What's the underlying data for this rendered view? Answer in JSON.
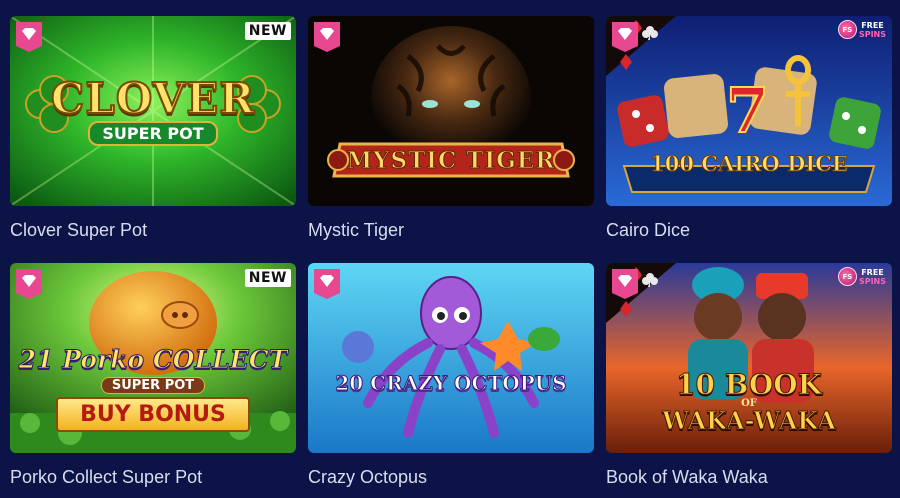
{
  "games": [
    {
      "title": "Clover Super Pot",
      "badge": "NEW",
      "logo_main": "CLOVER",
      "logo_sub": "SUPER POT"
    },
    {
      "title": "Mystic Tiger",
      "logo_main": "MYSTIC TIGER"
    },
    {
      "title": "Cairo Dice",
      "logo_main": "100 CAIRO DICE",
      "free_spins": [
        "FREE",
        "SPINS"
      ],
      "fs_logo": "FS"
    },
    {
      "title": "Porko Collect Super Pot",
      "badge": "NEW",
      "logo_main": "21 Porko COLLECT",
      "logo_sub": "SUPER POT",
      "logo_cta": "BUY BONUS"
    },
    {
      "title": "Crazy Octopus",
      "logo_main": "20 CRAZY OCTOPUS"
    },
    {
      "title": "Book of Waka Waka",
      "logo_main": "10 BOOK",
      "logo_mid": "OF",
      "logo_sub": "WAKA-WAKA",
      "free_spins": [
        "FREE",
        "SPINS"
      ],
      "fs_logo": "FS"
    }
  ],
  "colors": {
    "background": "#0c1447",
    "title_text": "#d9dcef",
    "gem_badge": "#e8488f"
  },
  "icons": [
    "diamond-gem-icon",
    "card-suits-icon",
    "free-spins-icon"
  ]
}
